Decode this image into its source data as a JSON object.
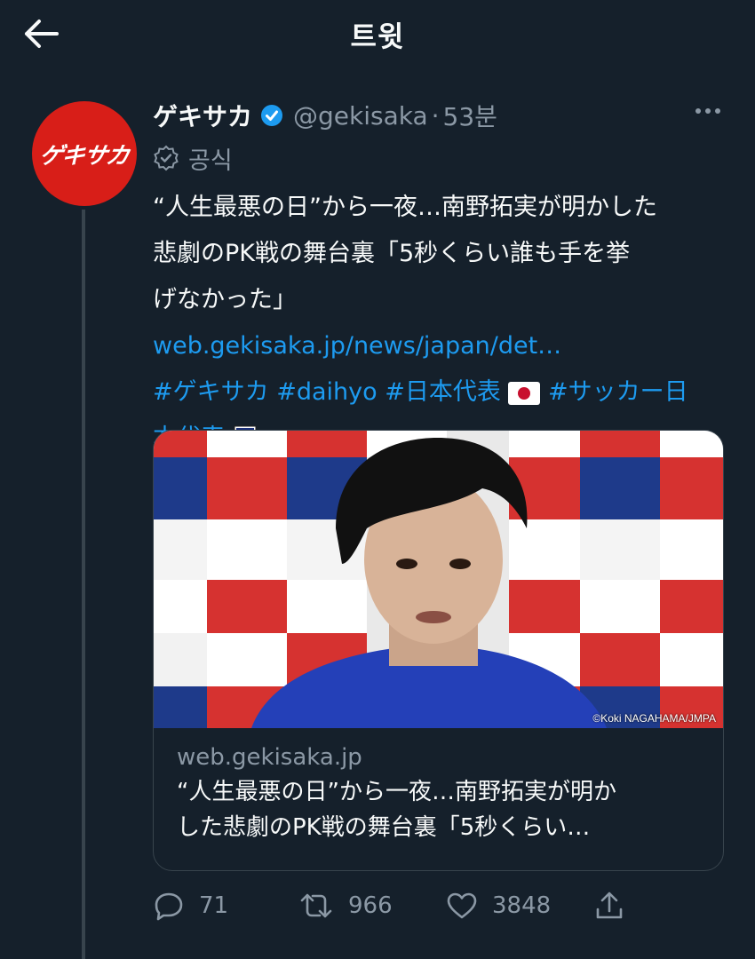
{
  "header": {
    "title": "트윗"
  },
  "author": {
    "avatar_text": "ゲキサカ",
    "name": "ゲキサカ",
    "handle": "@gekisaka",
    "separator": "·",
    "time": "53분",
    "official_label": "공식"
  },
  "tweet": {
    "text_lines": [
      "“人生最悪の日”から一夜…南野拓実が明かした",
      "悲劇のPK戦の舞台裏「5秒くらい誰も手を挙",
      "げなかった」"
    ],
    "link": "web.gekisaka.jp/news/japan/det…",
    "hashtags": [
      "#ゲキサカ",
      "#daihyo",
      "#日本代表",
      "#サッカー日",
      "本代表"
    ]
  },
  "card": {
    "image_credit": "©Koki NAGAHAMA/JMPA",
    "domain": "web.gekisaka.jp",
    "title_lines": [
      "“人生最悪の日”から一夜…南野拓実が明か",
      "した悲劇のPK戦の舞台裏「5秒くらい…"
    ]
  },
  "actions": {
    "replies": "71",
    "retweets": "966",
    "likes": "3848"
  },
  "colors": {
    "background": "#15202b",
    "accent": "#1d9bf0",
    "muted": "#8b98a5",
    "avatar": "#d81e18"
  },
  "icons": [
    "back-arrow-icon",
    "verified-badge-icon",
    "more-icon",
    "official-badge-icon",
    "japan-flag-icon",
    "jfa-emblem-icon",
    "reply-icon",
    "retweet-icon",
    "like-icon",
    "share-icon"
  ]
}
